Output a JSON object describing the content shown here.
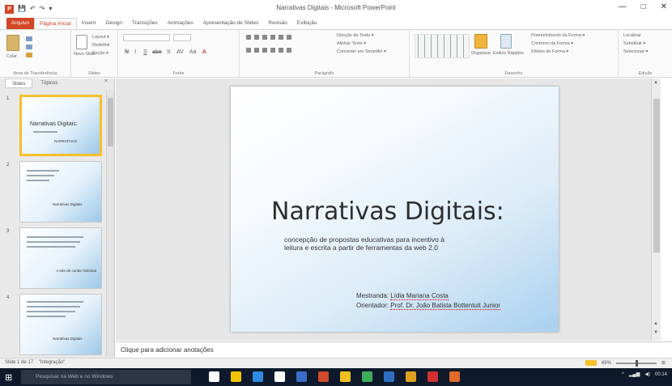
{
  "window": {
    "title": "Narrativas Digitais - Microsoft PowerPoint",
    "quick_access": [
      "💾",
      "↶",
      "↷",
      "▾"
    ],
    "controls": [
      "—",
      "□",
      "✕"
    ]
  },
  "ribbon_tabs": [
    {
      "label": "Arquivo"
    },
    {
      "label": "Página Inicial"
    },
    {
      "label": "Inserir"
    },
    {
      "label": "Design"
    },
    {
      "label": "Transições"
    },
    {
      "label": "Animações"
    },
    {
      "label": "Apresentação de Slides"
    },
    {
      "label": "Revisão"
    },
    {
      "label": "Exibição"
    }
  ],
  "ribbon": {
    "clipboard": {
      "label": "Área de Transferência",
      "paste": "Colar"
    },
    "slides": {
      "label": "Slides",
      "new_slide": "Novo Slide",
      "layout": "Layout ▾",
      "reset": "Redefinir",
      "section": "Seção ▾"
    },
    "font": {
      "label": "Fonte",
      "bold": "N",
      "italic": "I",
      "underline": "S",
      "strike": "abe",
      "shadow": "S",
      "spacing": "AV",
      "case": "Aa",
      "color": "A"
    },
    "paragraph": {
      "label": "Parágrafo",
      "direction": "Direção do Texto ▾",
      "align": "Alinhar Texto ▾",
      "smartart": "Converter em SmartArt ▾"
    },
    "drawing": {
      "label": "Desenho",
      "arrange": "Organizar",
      "quick_styles": "Estilos Rápidos",
      "fill": "Preenchimento da Forma ▾",
      "outline": "Contorno da Forma ▾",
      "effects": "Efeitos de Forma ▾"
    },
    "editing": {
      "label": "Edição",
      "find": "Localizar",
      "replace": "Substituir ▾",
      "select": "Selecionar ▾"
    }
  },
  "left_pane": {
    "tabs": [
      "Slides",
      "Tópicos"
    ],
    "close": "×",
    "slides": [
      {
        "num": "1",
        "title": "Narrativas Digitais:",
        "text": "NARRATIVAS"
      },
      {
        "num": "2",
        "title": "",
        "text": "Narrativas Digitais"
      },
      {
        "num": "3",
        "title": "",
        "text": "A arte de contar histórias"
      },
      {
        "num": "4",
        "title": "",
        "text": "Narrativas Digitais"
      }
    ]
  },
  "slide": {
    "title": "Narrativas Digitais:",
    "subtitle": "concepção de propostas educativas para incentivo à leitura e escrita a partir de ferramentas da web 2.0",
    "mestranda_label": "Mestranda:",
    "mestranda_name": "Lídia Mariana Costa",
    "orientador_label": "Orientador:",
    "orientador_name": "Prof. Dr. João Batista Bottentuit Junior"
  },
  "notes": {
    "placeholder": "Clique para adicionar anotações"
  },
  "status": {
    "slide_info": "Slide 1 de 17",
    "theme": "\"Integração\"",
    "zoom": "69%"
  },
  "taskbar": {
    "search_placeholder": "Pesquisar na Web e no Windows",
    "time": "00:14",
    "icon_colors": [
      "#ffffff",
      "#f2c200",
      "#2f8be0",
      "#ffffff",
      "#3a6ec9",
      "#d04a2a",
      "#f0c020",
      "#3cae5a",
      "#2f6dc4",
      "#e0a020",
      "#d03030",
      "#e06a2a"
    ]
  }
}
